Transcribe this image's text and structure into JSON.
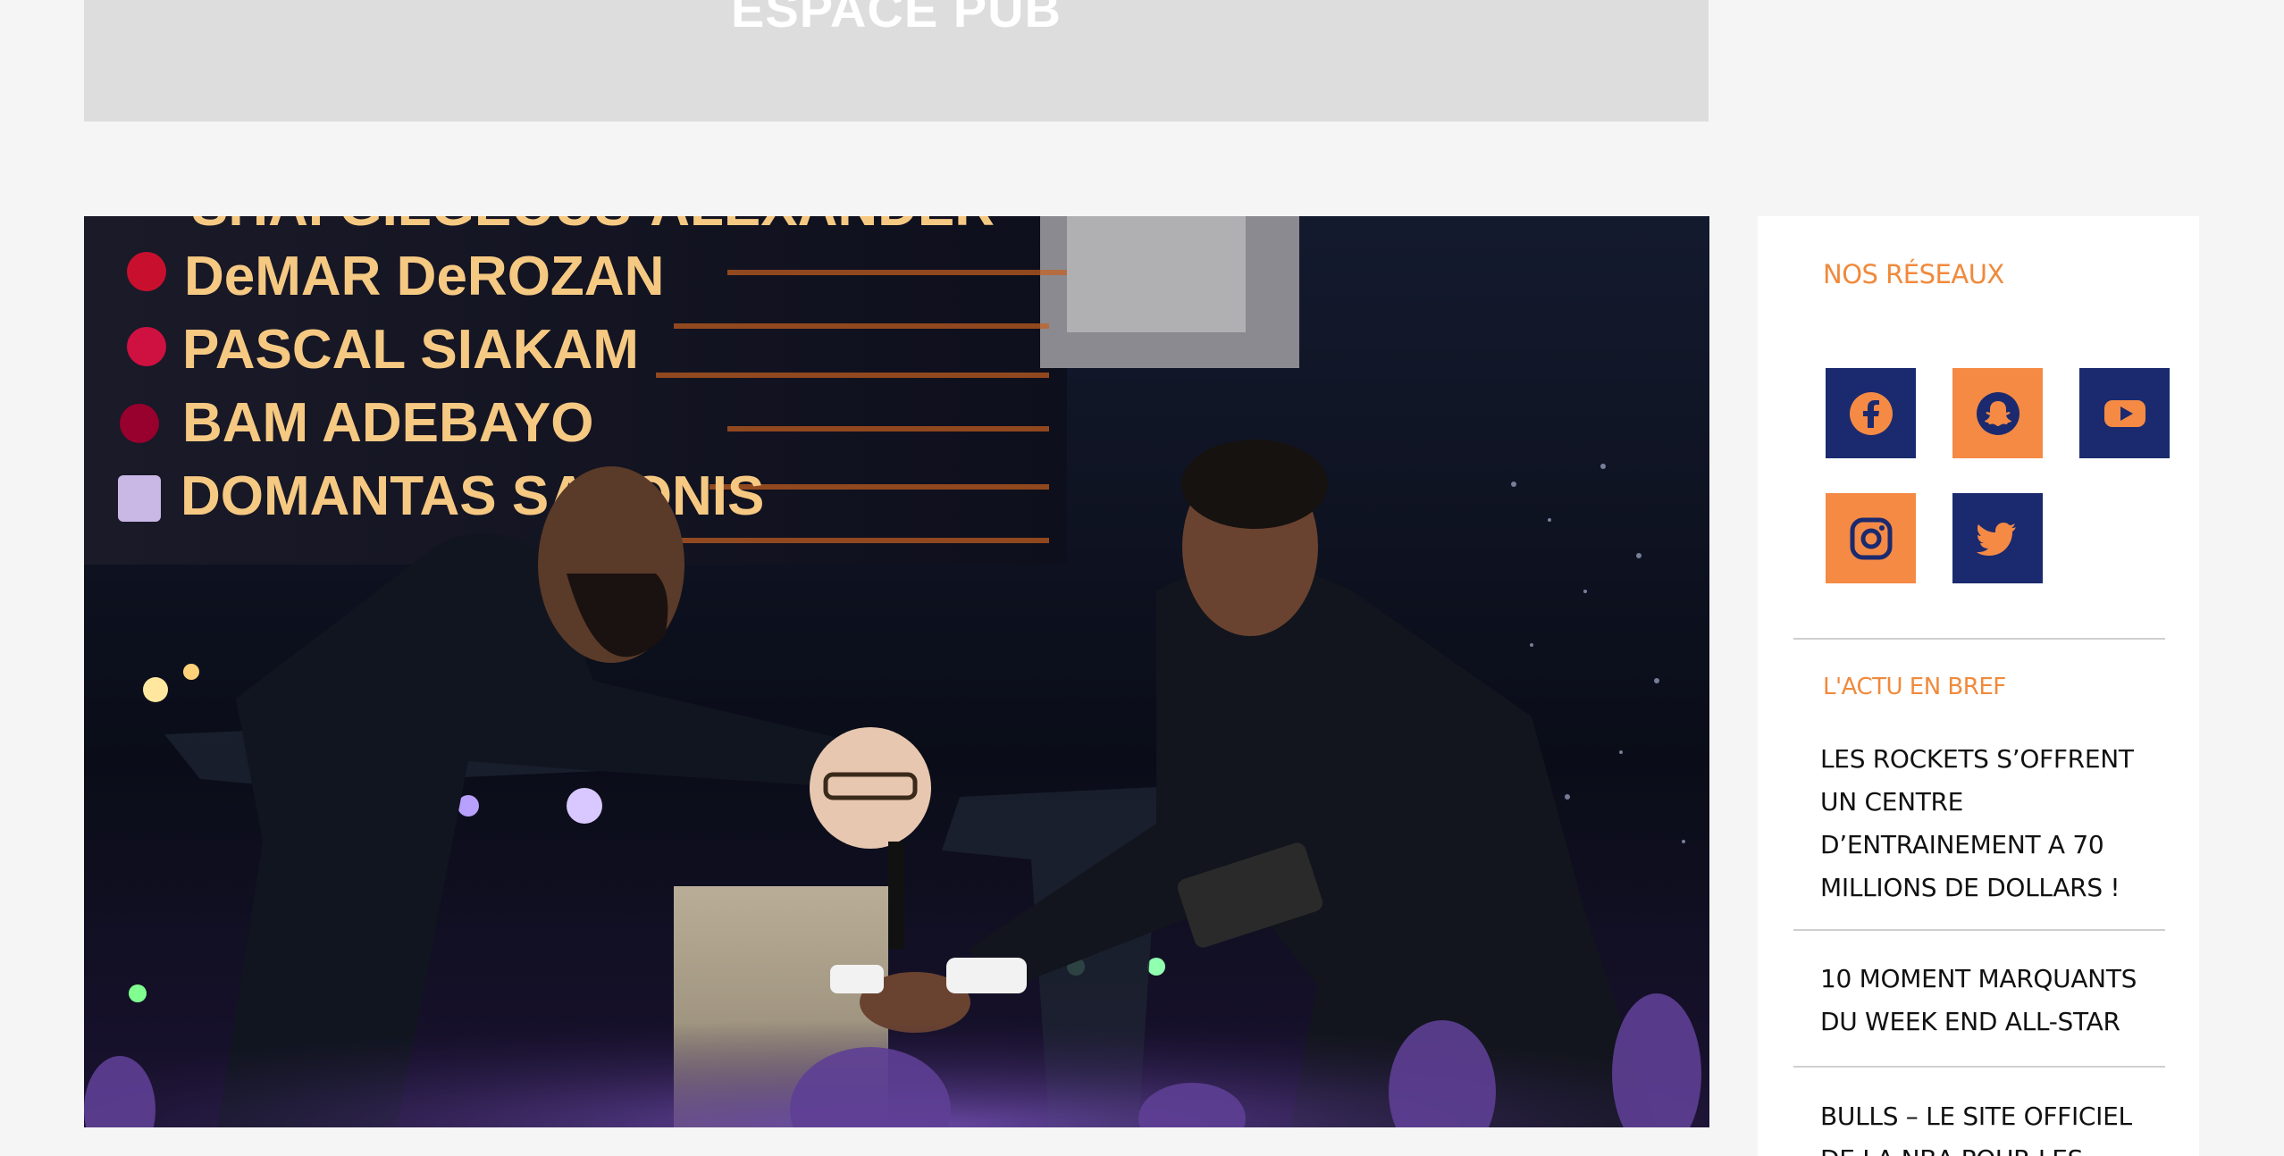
{
  "ad": {
    "label": "ESPACE PUB"
  },
  "hero": {
    "scoreboard_names": [
      "SHAI GILGEOUS-ALEXANDER",
      "DeMAR DeROZAN",
      "PASCAL SIAKAM",
      "BAM ADEBAYO",
      "DOMANTAS SABONIS"
    ]
  },
  "sidebar": {
    "reseaux_title": "NOS RÉSEAUX",
    "social_icons": [
      "facebook-icon",
      "snapchat-icon",
      "youtube-icon",
      "instagram-icon",
      "twitter-icon"
    ],
    "actu_title": "L'ACTU EN BREF",
    "news": [
      {
        "title": "LES ROCKETS S’OFFRENT UN CENTRE D’ENTRAINEMENT A 70 MILLIONS DE DOLLARS !"
      },
      {
        "title": "10 MOMENT MARQUANTS DU WEEK END ALL-STAR"
      },
      {
        "title": "BULLS – LE SITE OFFICIEL DE LA NBA POUR LES"
      }
    ]
  },
  "colors": {
    "accent": "#f08a3c",
    "navy": "#1b2a6e",
    "orange": "#f58a45"
  }
}
